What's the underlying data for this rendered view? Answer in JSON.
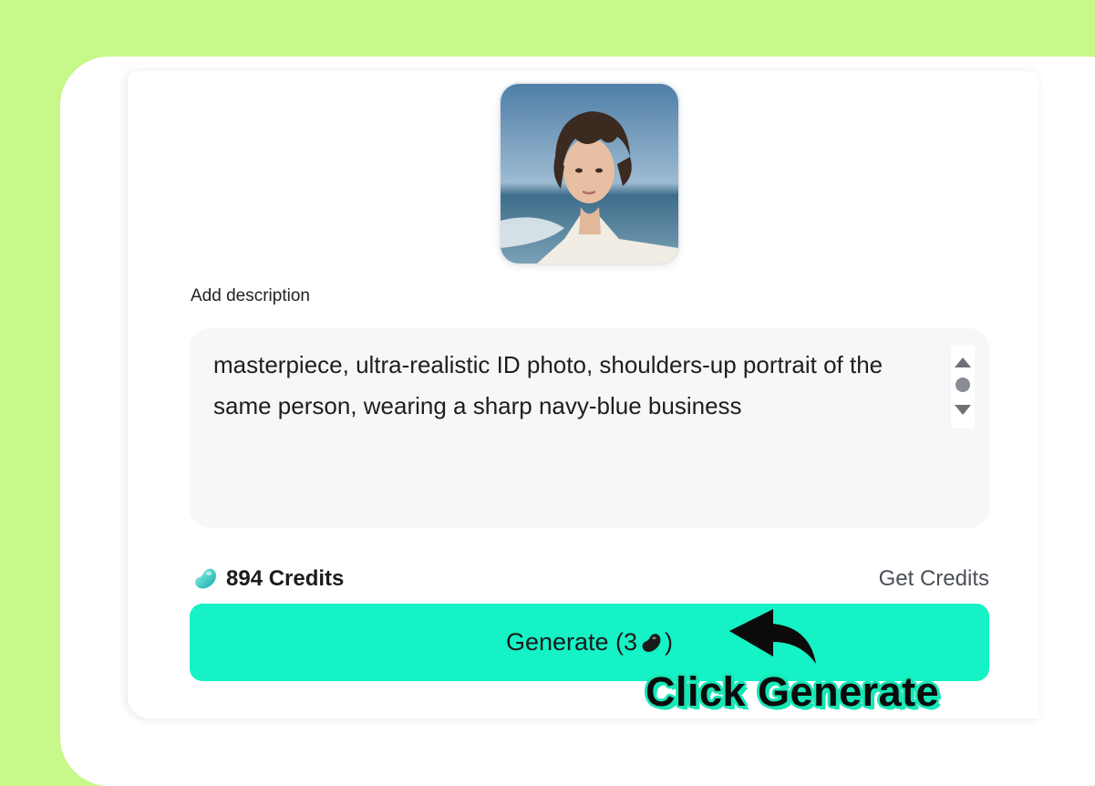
{
  "avatar": {
    "alt": "uploaded portrait photo"
  },
  "description": {
    "label": "Add description",
    "value": "masterpiece, ultra-realistic ID photo, shoulders-up portrait of the same person, wearing a sharp navy-blue business"
  },
  "credits": {
    "amount_text": "894 Credits",
    "get_credits_label": "Get Credits",
    "icon": "bean-icon"
  },
  "generate_button": {
    "label_prefix": "Generate (3",
    "label_suffix": ")",
    "cost": 3,
    "icon": "bean-icon"
  },
  "annotation": {
    "text": "Click Generate",
    "icon": "curved-arrow-icon"
  },
  "colors": {
    "background": "#c8f78a",
    "button": "#15f2c6",
    "annotation_outline": "#17e6b6"
  }
}
